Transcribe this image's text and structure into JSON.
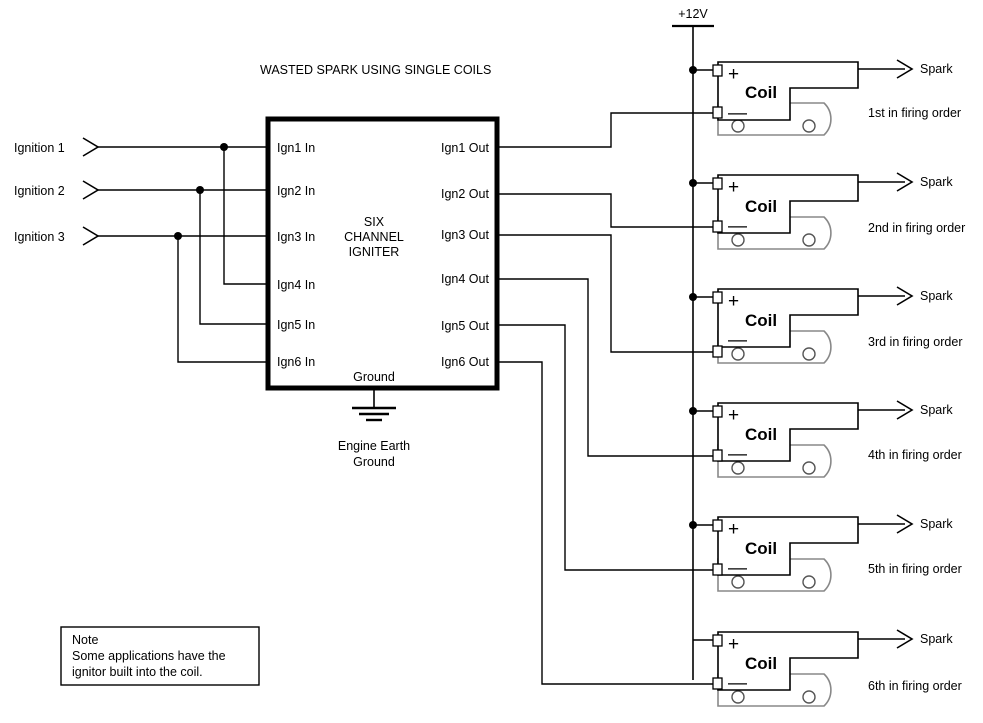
{
  "diagram": {
    "title": "WASTED SPARK USING SINGLE COILS",
    "power_rail": {
      "label": "+12V",
      "color": "#000000"
    },
    "ground": {
      "pin_label": "Ground",
      "caption_line1": "Engine Earth",
      "caption_line2": "Ground"
    },
    "igniter": {
      "name_line1": "SIX",
      "name_line2": "CHANNEL",
      "name_line3": "IGNITER",
      "inputs": [
        {
          "label": "Ign1 In"
        },
        {
          "label": "Ign2 In"
        },
        {
          "label": "Ign3 In"
        },
        {
          "label": "Ign4 In"
        },
        {
          "label": "Ign5 In"
        },
        {
          "label": "Ign6 In"
        }
      ],
      "outputs": [
        {
          "label": "Ign1 Out"
        },
        {
          "label": "Ign2 Out"
        },
        {
          "label": "Ign3 Out"
        },
        {
          "label": "Ign4 Out"
        },
        {
          "label": "Ign5 Out"
        },
        {
          "label": "Ign6 Out"
        }
      ]
    },
    "ignition_inputs": [
      {
        "label": "Ignition 1"
      },
      {
        "label": "Ignition 2"
      },
      {
        "label": "Ignition 3"
      }
    ],
    "coils": [
      {
        "body_label": "Coil",
        "plus": "+",
        "minus": "—",
        "spark_label": "Spark",
        "order_label": "1st in firing order"
      },
      {
        "body_label": "Coil",
        "plus": "+",
        "minus": "—",
        "spark_label": "Spark",
        "order_label": "2nd in firing order"
      },
      {
        "body_label": "Coil",
        "plus": "+",
        "minus": "—",
        "spark_label": "Spark",
        "order_label": "3rd in firing order"
      },
      {
        "body_label": "Coil",
        "plus": "+",
        "minus": "—",
        "spark_label": "Spark",
        "order_label": "4th in firing order"
      },
      {
        "body_label": "Coil",
        "plus": "+",
        "minus": "—",
        "spark_label": "Spark",
        "order_label": "5th in firing order"
      },
      {
        "body_label": "Coil",
        "plus": "+",
        "minus": "—",
        "spark_label": "Spark",
        "order_label": "6th in firing order"
      }
    ],
    "note": {
      "line1": "Note",
      "line2": "Some applications have the",
      "line3": "ignitor built into the coil."
    }
  }
}
